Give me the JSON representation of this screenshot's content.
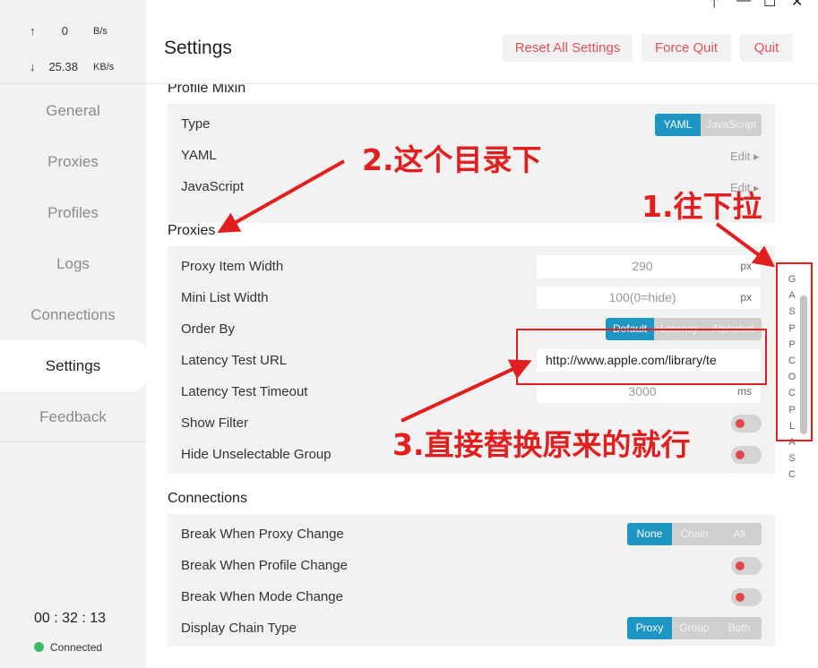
{
  "window_controls": [
    "🡑",
    "—",
    "☐",
    "✕"
  ],
  "traffic": {
    "up_arrow": "↑",
    "up_value": "0",
    "up_unit": "B/s",
    "down_arrow": "↓",
    "down_value": "25.38",
    "down_unit": "KB/s"
  },
  "sidebar": {
    "items": [
      {
        "label": "General"
      },
      {
        "label": "Proxies"
      },
      {
        "label": "Profiles"
      },
      {
        "label": "Logs"
      },
      {
        "label": "Connections"
      },
      {
        "label": "Settings",
        "active": true
      },
      {
        "label": "Feedback"
      }
    ],
    "clock": "00 : 32 : 13",
    "status": "Connected"
  },
  "header": {
    "title": "Settings",
    "reset_label": "Reset All Settings",
    "force_quit_label": "Force Quit",
    "quit_label": "Quit"
  },
  "profile_mixin": {
    "title": "Profile Mixin",
    "type_label": "Type",
    "type_options": [
      "YAML",
      "JavaScript"
    ],
    "type_selected": "YAML",
    "yaml_label": "YAML",
    "yaml_edit": "Edit ▸",
    "js_label": "JavaScript",
    "js_edit": "Edit ▸"
  },
  "proxies": {
    "title": "Proxies",
    "item_width_label": "Proxy Item Width",
    "item_width_value": "290",
    "item_width_unit": "px",
    "mini_list_label": "Mini List Width",
    "mini_list_placeholder": "100(0=hide)",
    "mini_list_unit": "px",
    "order_by_label": "Order By",
    "order_by_options": [
      "Default",
      "Latency",
      "Alphabet"
    ],
    "order_by_selected": "Default",
    "latency_url_label": "Latency Test URL",
    "latency_url_value": "http://www.apple.com/library/te",
    "latency_timeout_label": "Latency Test Timeout",
    "latency_timeout_value": "3000",
    "latency_timeout_unit": "ms",
    "show_filter_label": "Show Filter",
    "hide_unselectable_label": "Hide Unselectable Group"
  },
  "connections": {
    "title": "Connections",
    "break_proxy_label": "Break When Proxy Change",
    "break_proxy_options": [
      "None",
      "Chain",
      "All"
    ],
    "break_proxy_selected": "None",
    "break_profile_label": "Break When Profile Change",
    "break_mode_label": "Break When Mode Change",
    "chain_type_label": "Display Chain Type",
    "chain_type_options": [
      "Proxy",
      "Group",
      "Both"
    ],
    "chain_type_selected": "Proxy"
  },
  "scroll_index": [
    "G",
    "A",
    "S",
    "P",
    "P",
    "C",
    "O",
    "C",
    "P",
    "L",
    "A",
    "S",
    "C"
  ],
  "annotations": {
    "note1": "1.往下拉",
    "note2": "2.这个目录下",
    "note3": "3.直接替换原来的就行",
    "color": "#e21e1e"
  },
  "colors": {
    "accent": "#1e96c3",
    "danger_text": "#e0505a",
    "toggle_off_dot": "#e04848",
    "connected": "#3cba6a"
  }
}
